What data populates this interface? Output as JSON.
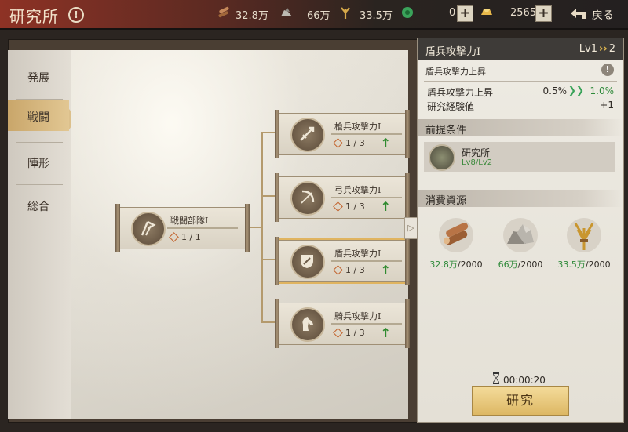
{
  "header": {
    "title": "研究所",
    "resources": [
      {
        "icon": "wood-icon",
        "value": "32.8万"
      },
      {
        "icon": "stone-icon",
        "value": "66万"
      },
      {
        "icon": "grain-icon",
        "value": "33.5万"
      },
      {
        "icon": "jade-icon",
        "value": "0"
      },
      {
        "icon": "gold-icon",
        "value": "2565"
      }
    ],
    "back_label": "戻る"
  },
  "sidebar": {
    "tabs": [
      {
        "label": "発展",
        "active": false
      },
      {
        "label": "戦闘",
        "active": true
      },
      {
        "label": "陣形",
        "active": false
      },
      {
        "label": "総合",
        "active": false
      }
    ]
  },
  "tree": {
    "root": {
      "name": "戦闘部隊Ⅰ",
      "level": "1 / 1"
    },
    "children": [
      {
        "name": "槍兵攻撃力Ⅰ",
        "level": "1 / 3",
        "icon": "spear-icon",
        "selected": false
      },
      {
        "name": "弓兵攻撃力Ⅰ",
        "level": "1 / 3",
        "icon": "bow-icon",
        "selected": false
      },
      {
        "name": "盾兵攻撃力Ⅰ",
        "level": "1 / 3",
        "icon": "shield-icon",
        "selected": true
      },
      {
        "name": "騎兵攻撃力Ⅰ",
        "level": "1 / 3",
        "icon": "horse-icon",
        "selected": false
      }
    ]
  },
  "panel": {
    "title": "盾兵攻撃力Ⅰ",
    "level_from": "Lv1",
    "level_to": "2",
    "description": "盾兵攻撃力上昇",
    "stats": [
      {
        "name": "盾兵攻撃力上昇",
        "from": "0.5%",
        "to": "1.0%"
      },
      {
        "name": "研究経験値",
        "value": "+1"
      }
    ],
    "prereq_header": "前提条件",
    "prereq": {
      "name": "研究所",
      "have": "Lv8",
      "need": "/Lv2"
    },
    "cost_header": "消費資源",
    "costs": [
      {
        "icon": "wood-icon",
        "have": "32.8万",
        "need": "/2000"
      },
      {
        "icon": "stone-icon",
        "have": "66万",
        "need": "/2000"
      },
      {
        "icon": "grain-icon",
        "have": "33.5万",
        "need": "/2000"
      }
    ],
    "timer": "00:00:20",
    "research_label": "研究"
  }
}
